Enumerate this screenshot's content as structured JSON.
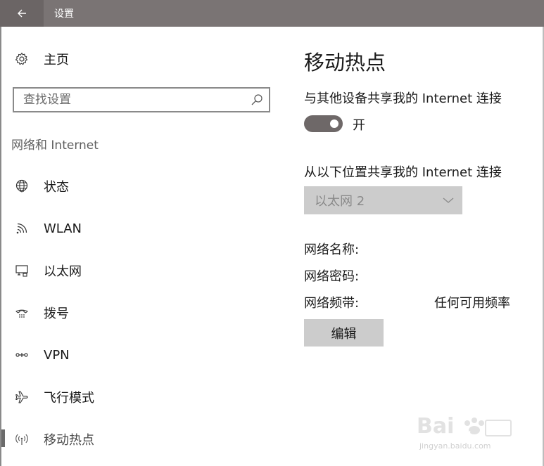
{
  "window": {
    "title": "设置"
  },
  "sidebar": {
    "home_label": "主页",
    "search_placeholder": "查找设置",
    "section_heading": "网络和 Internet",
    "items": [
      {
        "label": "状态",
        "icon": "globe-icon"
      },
      {
        "label": "WLAN",
        "icon": "wifi-icon"
      },
      {
        "label": "以太网",
        "icon": "ethernet-icon"
      },
      {
        "label": "拨号",
        "icon": "dialup-icon"
      },
      {
        "label": "VPN",
        "icon": "vpn-icon"
      },
      {
        "label": "飞行模式",
        "icon": "airplane-icon"
      },
      {
        "label": "移动热点",
        "icon": "hotspot-icon",
        "selected": true
      }
    ]
  },
  "main": {
    "title": "移动热点",
    "share_label": "与其他设备共享我的 Internet 连接",
    "toggle": {
      "on": true,
      "state_text": "开"
    },
    "from_label": "从以下位置共享我的 Internet 连接",
    "from_dropdown": {
      "value": "以太网 2"
    },
    "network_name_label": "网络名称:",
    "network_password_label": "网络密码:",
    "network_band_label": "网络频带:",
    "network_band_value": "任何可用频率",
    "edit_button": "编辑"
  },
  "watermark": {
    "text": "jingyan.baidu.com"
  },
  "colors": {
    "titlebar": "#7a7474",
    "toggle_on": "#6e6868",
    "button_bg": "#cccccc"
  }
}
